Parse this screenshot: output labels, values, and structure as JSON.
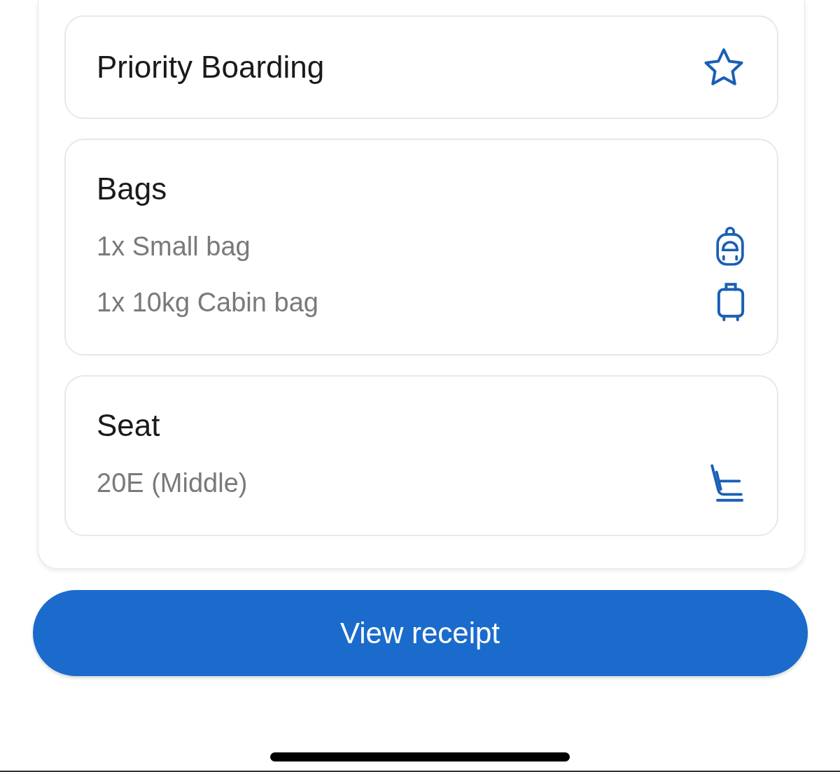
{
  "cards": [
    {
      "kind": "starred",
      "title": "Priority Boarding"
    },
    {
      "kind": "list",
      "title": "Bags",
      "items": [
        {
          "kind": "backpack",
          "text": "1x Small bag"
        },
        {
          "kind": "suitcase",
          "text": "1x 10kg Cabin bag"
        }
      ]
    },
    {
      "kind": "list",
      "title": "Seat",
      "items": [
        {
          "kind": "seat",
          "text": "20E (Middle)"
        }
      ]
    }
  ],
  "button": "View receipt"
}
